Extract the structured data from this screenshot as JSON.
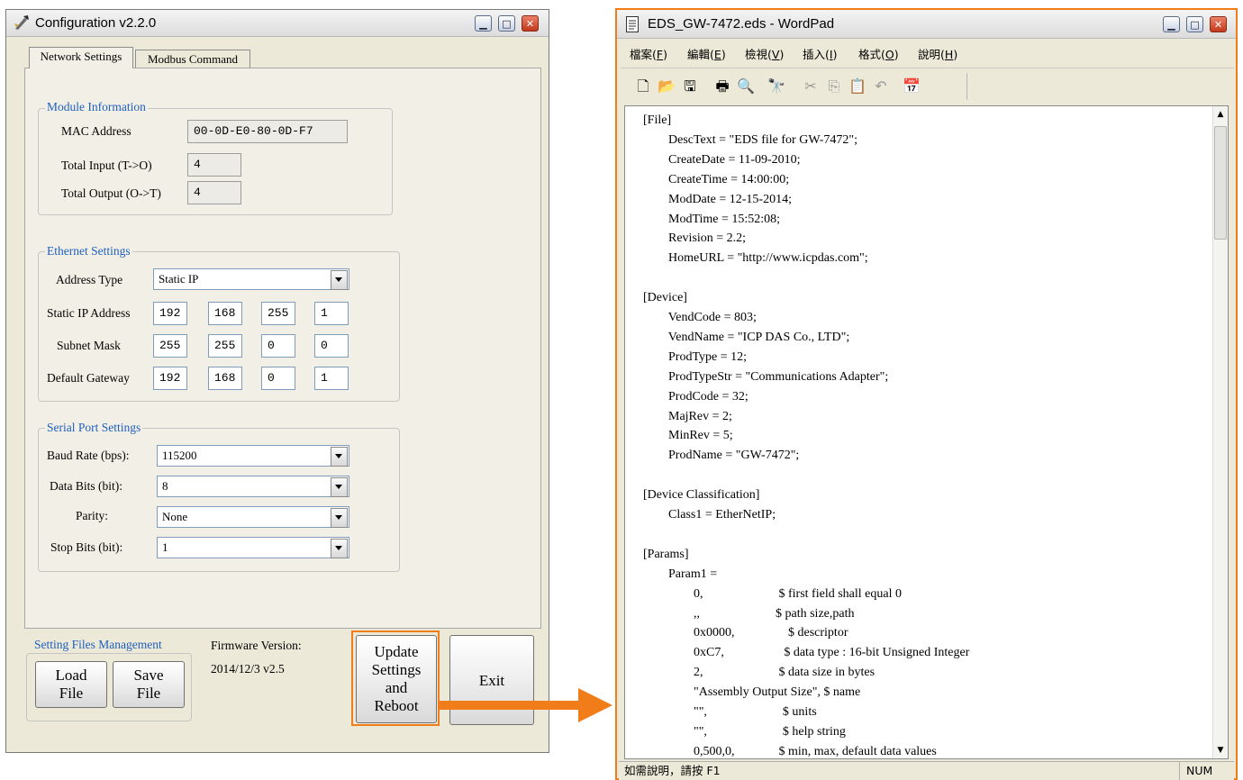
{
  "config": {
    "title": "Configuration  v2.2.0",
    "tabs": [
      "Network Settings",
      "Modbus Command"
    ],
    "module_info": {
      "title": "Module Information",
      "mac_label": "MAC Address",
      "mac_value": "00-0D-E0-80-0D-F7",
      "total_input_label": "Total Input   (T->O)",
      "total_input_value": "4",
      "total_output_label": "Total Output (O->T)",
      "total_output_value": "4"
    },
    "ethernet": {
      "title": "Ethernet Settings",
      "address_type_label": "Address Type",
      "address_type_value": "Static IP",
      "static_ip_label": "Static IP Address",
      "static_ip": [
        "192",
        "168",
        "255",
        "1"
      ],
      "subnet_label": "Subnet Mask",
      "subnet": [
        "255",
        "255",
        "0",
        "0"
      ],
      "gateway_label": "Default Gateway",
      "gateway": [
        "192",
        "168",
        "0",
        "1"
      ]
    },
    "serial": {
      "title": "Serial Port Settings",
      "baud_label": "Baud Rate (bps):",
      "baud_value": "115200",
      "data_bits_label": "Data Bits (bit):",
      "data_bits_value": "8",
      "parity_label": "Parity:",
      "parity_value": "None",
      "stop_bits_label": "Stop Bits (bit):",
      "stop_bits_value": "1"
    },
    "files": {
      "title": "Setting Files Management",
      "load_label": [
        "Load",
        "File"
      ],
      "save_label": [
        "Save",
        "File"
      ]
    },
    "firmware_label": "Firmware Version:",
    "firmware_value": "2014/12/3 v2.5",
    "update_label": [
      "Update",
      "Settings",
      "and",
      "Reboot"
    ],
    "exit_label": "Exit"
  },
  "wordpad": {
    "title": "EDS_GW-7472.eds - WordPad",
    "menu": [
      {
        "label": "檔案",
        "key": "F"
      },
      {
        "label": "編輯",
        "key": "E"
      },
      {
        "label": "檢視",
        "key": "V"
      },
      {
        "label": "插入",
        "key": "I"
      },
      {
        "label": "格式",
        "key": "O"
      },
      {
        "label": "說明",
        "key": "H"
      }
    ],
    "toolbar_icons": [
      "new-icon",
      "open-icon",
      "save-icon",
      "print-icon",
      "print-preview-icon",
      "find-icon",
      "cut-icon",
      "copy-icon",
      "paste-icon",
      "undo-icon",
      "insert-datetime-icon"
    ],
    "document_lines": [
      "[File]",
      "        DescText = \"EDS file for GW-7472\";",
      "        CreateDate = 11-09-2010;",
      "        CreateTime = 14:00:00;",
      "        ModDate = 12-15-2014;",
      "        ModTime = 15:52:08;",
      "        Revision = 2.2;",
      "        HomeURL = \"http://www.icpdas.com\";",
      "",
      "[Device]",
      "        VendCode = 803;",
      "        VendName = \"ICP DAS Co., LTD\";",
      "        ProdType = 12;",
      "        ProdTypeStr = \"Communications Adapter\";",
      "        ProdCode = 32;",
      "        MajRev = 2;",
      "        MinRev = 5;",
      "        ProdName = \"GW-7472\";",
      "",
      "[Device Classification]",
      "        Class1 = EtherNetIP;",
      "",
      "[Params]",
      "        Param1 =",
      "                0,                        $ first field shall equal 0",
      "                ,,                        $ path size,path",
      "                0x0000,                 $ descriptor",
      "                0xC7,                   $ data type : 16-bit Unsigned Integer",
      "                2,                        $ data size in bytes",
      "                \"Assembly Output Size\", $ name",
      "                \"\",                        $ units",
      "                \"\",                        $ help string",
      "                0,500,0,              $ min, max, default data values"
    ],
    "status_help": "如需說明，請按 F1",
    "status_num": "NUM"
  },
  "colors": {
    "accent": "#f07d1a",
    "group_title": "#1f5fbf"
  }
}
